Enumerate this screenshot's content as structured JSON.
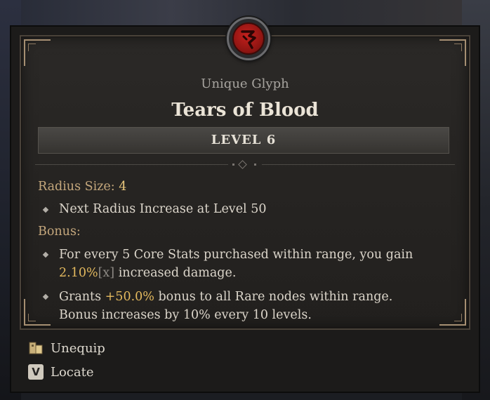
{
  "glyph": {
    "rarity_label": "Unique Glyph",
    "name": "Tears of Blood",
    "level_label": "LEVEL 6",
    "emblem_color": "#b71c1a",
    "emblem_icon": "glyph-rune-icon"
  },
  "stats": {
    "radius_label": "Radius Size:",
    "radius_value": "4",
    "radius_bullet": "Next Radius Increase at Level 50",
    "bonus_label": "Bonus:",
    "bonus_1_prefix": "For every 5 Core Stats purchased within range, you gain",
    "bonus_1_value": "2.10%",
    "bonus_1_tag": "[x]",
    "bonus_1_suffix": "increased damage.",
    "bonus_2_prefix": "Grants",
    "bonus_2_value": "+50.0%",
    "bonus_2_suffix": "bonus to all Rare nodes within range.",
    "bonus_2_line2": "Bonus increases by 10% every 10 levels."
  },
  "actions": {
    "unequip_label": "Unequip",
    "locate_label": "Locate",
    "locate_key": "V"
  },
  "colors": {
    "gold_label": "#c4a77c",
    "gold_value": "#e9c77c",
    "highlight": "#e3b95e"
  }
}
